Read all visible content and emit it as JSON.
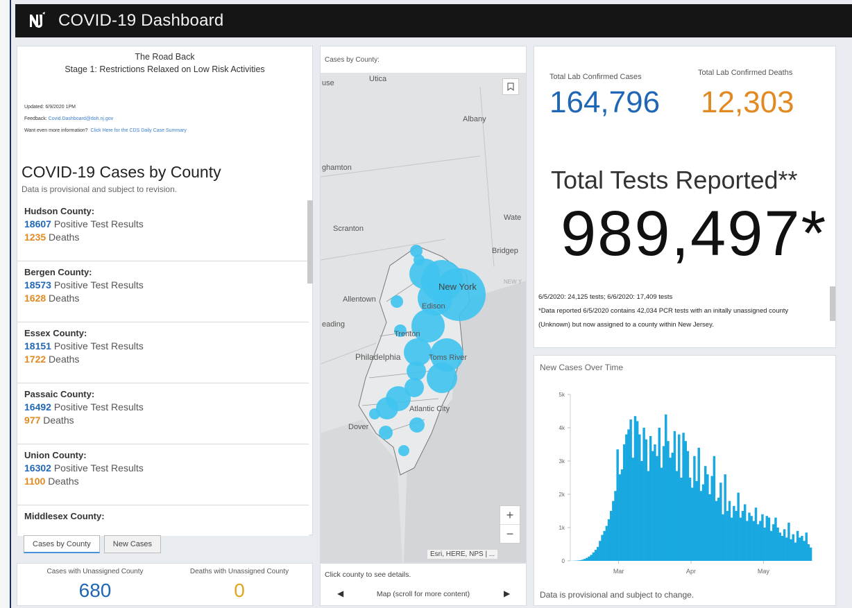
{
  "header": {
    "title": "COVID-19 Dashboard"
  },
  "left": {
    "road_title": "The Road Back",
    "road_subtitle": "Stage 1: Restrictions Relaxed on Low Risk Activities",
    "updated": "Updated: 6/9/2020 1PM",
    "feedback_label": "Feedback:",
    "feedback_link": "Covid.Dashboard@doh.nj.gov",
    "more_info_label": "Want even more information?",
    "more_info_link": "Click Here for the CDS Daily Case Summary",
    "cases_title": "COVID-19 Cases by County",
    "cases_sub": "Data is provisional and subject to revision.",
    "counties": [
      {
        "name": "Hudson County:",
        "positive": "18607",
        "positive_label": " Positive Test Results",
        "deaths": "1235",
        "deaths_label": " Deaths"
      },
      {
        "name": "Bergen County:",
        "positive": "18573",
        "positive_label": " Positive Test Results",
        "deaths": "1628",
        "deaths_label": " Deaths"
      },
      {
        "name": "Essex County:",
        "positive": "18151",
        "positive_label": " Positive Test Results",
        "deaths": "1722",
        "deaths_label": " Deaths"
      },
      {
        "name": "Passaic County:",
        "positive": "16492",
        "positive_label": " Positive Test Results",
        "deaths": "977",
        "deaths_label": " Deaths"
      },
      {
        "name": "Union County:",
        "positive": "16302",
        "positive_label": " Positive Test Results",
        "deaths": "1100",
        "deaths_label": " Deaths"
      },
      {
        "name": "Middlesex County:",
        "positive": "",
        "positive_label": "",
        "deaths": "",
        "deaths_label": ""
      }
    ],
    "tabs": [
      "Cases by County",
      "New Cases"
    ],
    "unassigned_cases_label": "Cases with Unassigned County",
    "unassigned_cases": "680",
    "unassigned_deaths_label": "Deaths with Unassigned County",
    "unassigned_deaths": "0"
  },
  "map": {
    "title": "Cases by County:",
    "labels": {
      "utica": "Utica",
      "use": "use",
      "albany": "Albany",
      "binghamton": "ghamton",
      "scranton": "Scranton",
      "wate": "Wate",
      "bridgep": "Bridgep",
      "newyork": "New York",
      "allentown": "Allentown",
      "edison": "Edison",
      "reading": "eading",
      "trenton": "Trenton",
      "philadelphia": "Philadelphia",
      "tomsriver": "Toms River",
      "atlantic": "Atlantic City",
      "dover": "Dover",
      "newy_faint": "NEW Y"
    },
    "attribution": "Esri, HERE, NPS | ...",
    "zoom_in": "+",
    "zoom_out": "−",
    "footer_hint": "Click county to see details.",
    "footer_nav": "Map (scroll for more content)"
  },
  "totals": {
    "cases_label": "Total Lab Confirmed Cases",
    "cases": "164,796",
    "deaths_label": "Total Lab Confirmed Deaths",
    "deaths": "12,303",
    "tests_title": "Total Tests Reported**",
    "tests": "989,497*",
    "note1": "6/5/2020: 24,125 tests; 6/6/2020: 17,409 tests",
    "note2": "*Data reported 6/5/2020 contains 42,034 PCR tests with an initally unassigned county (Unknown) but now assigned to a county within New Jersey."
  },
  "colors": {
    "blue": "#1f66b5",
    "orange": "#e28a22",
    "bubble": "#3fc3ef",
    "bar": "#19a8e0"
  },
  "chart_data": {
    "type": "bar",
    "title": "New Cases Over Time",
    "ylabel": "",
    "xlabel": "",
    "ylim": [
      0,
      5000
    ],
    "yticks": [
      "0",
      "1k",
      "2k",
      "3k",
      "4k",
      "5k"
    ],
    "xticks": [
      "Mar",
      "Apr",
      "May"
    ],
    "values": [
      2,
      5,
      8,
      12,
      20,
      35,
      60,
      90,
      130,
      180,
      250,
      330,
      420,
      600,
      780,
      900,
      1050,
      1250,
      1500,
      1800,
      2100,
      3350,
      2600,
      2750,
      3500,
      3800,
      3950,
      4250,
      3100,
      4350,
      4200,
      3800,
      3000,
      4000,
      3650,
      2700,
      3750,
      3300,
      3500,
      3150,
      4000,
      2800,
      3450,
      4400,
      3600,
      3100,
      3250,
      3900,
      2700,
      3800,
      2500,
      3850,
      3600,
      3300,
      2500,
      2200,
      3150,
      2400,
      3400,
      2100,
      2300,
      2850,
      2600,
      2000,
      2550,
      3150,
      1800,
      1900,
      2350,
      1400,
      2600,
      1500,
      1800,
      1300,
      1650,
      1500,
      2050,
      1300,
      1500,
      1700,
      1200,
      1450,
      1350,
      1200,
      1600,
      1100,
      1200,
      1400,
      1000,
      1350,
      1300,
      900,
      1100,
      1300,
      1000,
      850,
      750,
      950,
      700,
      1150,
      650,
      800,
      550,
      900,
      700,
      750,
      600,
      850,
      500,
      400
    ],
    "footer": "Data is provisional and subject to change."
  }
}
